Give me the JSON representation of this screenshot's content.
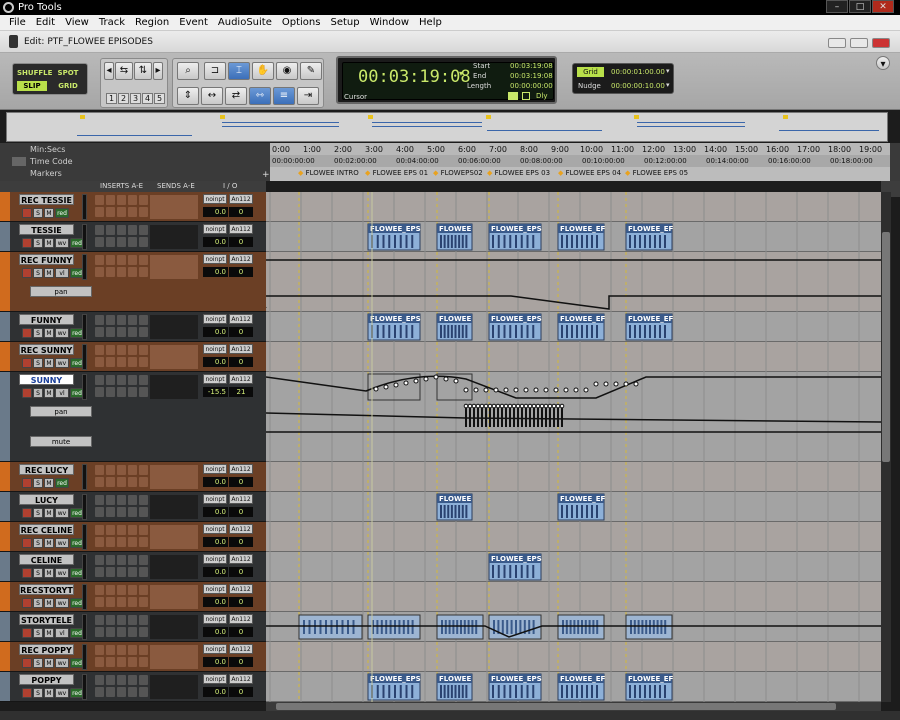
{
  "window": {
    "title": "Pro Tools"
  },
  "menu": [
    "File",
    "Edit",
    "View",
    "Track",
    "Region",
    "Event",
    "AudioSuite",
    "Options",
    "Setup",
    "Window",
    "Help"
  ],
  "edit_window": {
    "title": "Edit: PTF_FLOWEE EPISODES"
  },
  "edit_modes": {
    "shuffle": "SHUFFLE",
    "spot": "SPOT",
    "slip": "SLIP",
    "grid": "GRID"
  },
  "zoom_presets": [
    "1",
    "2",
    "3",
    "4",
    "5"
  ],
  "counter": {
    "main": "00:03:19:08",
    "start_label": "Start",
    "start": "00:03:19:08",
    "end_label": "End",
    "end": "00:03:19:08",
    "length_label": "Length",
    "length": "00:00:00:00",
    "cursor_label": "Cursor",
    "dly_label": "Dly"
  },
  "grid_nudge": {
    "grid_label": "Grid",
    "grid_value": "00:00:01:00.00",
    "nudge_label": "Nudge",
    "nudge_value": "00:00:00:10.00"
  },
  "rulers": {
    "minsecs_label": "Min:Secs",
    "minsecs": [
      "0:00",
      "1:00",
      "2:00",
      "3:00",
      "4:00",
      "5:00",
      "6:00",
      "7:00",
      "8:00",
      "9:00",
      "10:00",
      "11:00",
      "12:00",
      "13:00",
      "14:00",
      "15:00",
      "16:00",
      "17:00",
      "18:00",
      "19:00"
    ],
    "timecode_label": "Time Code",
    "timecode": [
      "00:00:00:00",
      "00:02:00:00",
      "00:04:00:00",
      "00:06:00:00",
      "00:08:00:00",
      "00:10:00:00",
      "00:12:00:00",
      "00:14:00:00",
      "00:16:00:00",
      "00:18:00:00"
    ],
    "markers_label": "Markers",
    "markers": [
      "FLOWEE INTRO",
      "FLOWEE EPS 01",
      "FLOWEPS02",
      "FLOWEE EPS 03",
      "FLOWEE EPS 04",
      "FLOWEE EPS 05"
    ]
  },
  "columns": {
    "inserts": "INSERTS A-E",
    "sends": "SENDS A-E",
    "io": "I / O"
  },
  "tracks": [
    {
      "name": "REC TESSIE",
      "type": "rec",
      "input": "noinpt",
      "output": "An112",
      "volume": "0.0",
      "pan": "0"
    },
    {
      "name": "TESSIE",
      "type": "aud",
      "input": "noinpt",
      "output": "An112",
      "volume": "0.0",
      "pan": "0",
      "view": "wv"
    },
    {
      "name": "REC FUNNY",
      "type": "rec",
      "input": "noinpt",
      "output": "An112",
      "volume": "0.0",
      "pan": "0",
      "view": "vl",
      "automation": [
        "pan"
      ]
    },
    {
      "name": "FUNNY",
      "type": "aud",
      "input": "noinpt",
      "output": "An112",
      "volume": "0.0",
      "pan": "0",
      "view": "wv"
    },
    {
      "name": "REC SUNNY",
      "type": "rec",
      "input": "noinpt",
      "output": "An112",
      "volume": "0.0",
      "pan": "0",
      "view": "wv"
    },
    {
      "name": "SUNNY",
      "type": "aud",
      "input": "noinpt",
      "output": "An112",
      "volume": "-15.5",
      "pan": "21",
      "view": "vl",
      "selected": true,
      "automation": [
        "pan",
        "mute"
      ]
    },
    {
      "name": "REC LUCY",
      "type": "rec",
      "input": "noinpt",
      "output": "An112",
      "volume": "0.0",
      "pan": "0"
    },
    {
      "name": "LUCY",
      "type": "aud",
      "input": "noinpt",
      "output": "An112",
      "volume": "0.0",
      "pan": "0",
      "view": "wv"
    },
    {
      "name": "REC CELINE",
      "type": "rec",
      "input": "noinpt",
      "output": "An112",
      "volume": "0.0",
      "pan": "0",
      "view": "wv"
    },
    {
      "name": "CELINE",
      "type": "aud",
      "input": "noinpt",
      "output": "An112",
      "volume": "0.0",
      "pan": "0",
      "view": "wv"
    },
    {
      "name": "RECSTORYT",
      "type": "rec",
      "input": "noinpt",
      "output": "An112",
      "volume": "0.0",
      "pan": "0",
      "view": "wv"
    },
    {
      "name": "STORYTELE",
      "type": "aud",
      "input": "noinpt",
      "output": "An112",
      "volume": "0.0",
      "pan": "0",
      "view": "vl"
    },
    {
      "name": "REC POPPY",
      "type": "rec",
      "input": "noinpt",
      "output": "An112",
      "volume": "0.0",
      "pan": "0",
      "view": "wv"
    },
    {
      "name": "POPPY",
      "type": "aud",
      "input": "noinpt",
      "output": "An112",
      "volume": "0.0",
      "pan": "0",
      "view": "wv"
    }
  ],
  "regions": {
    "tessie": [
      "FLOWEE_EPS",
      "FLOWEE",
      "FLOWEE_EPS",
      "FLOWEE_EF",
      "FLOWEE_EF"
    ],
    "funny": [
      "FLOWEE_EPS",
      "FLOWEE",
      "FLOWEE_EPS",
      "FLOWEE_EF",
      "FLOWEE_EF"
    ],
    "lucy": [
      "FLOWEE",
      "FLOWEE_EF"
    ],
    "celine": [
      "FLOWEE_EPS"
    ],
    "poppy": [
      "FLOWEE_EPS",
      "FLOWEE",
      "FLOWEE_EPS",
      "FLOWEE_EF",
      "FLOWEE_EF"
    ]
  },
  "buttons": {
    "solo": "S",
    "mute": "M",
    "rec_view": "red"
  },
  "lane_labels": {
    "left": "L",
    "right": "R"
  },
  "colors": {
    "region": "#8db0d8",
    "region_header": "#3a5a8a",
    "rec_track": "#6b3f25",
    "accent_orange": "#d06b1e",
    "lcd_text": "#c9e86a"
  }
}
